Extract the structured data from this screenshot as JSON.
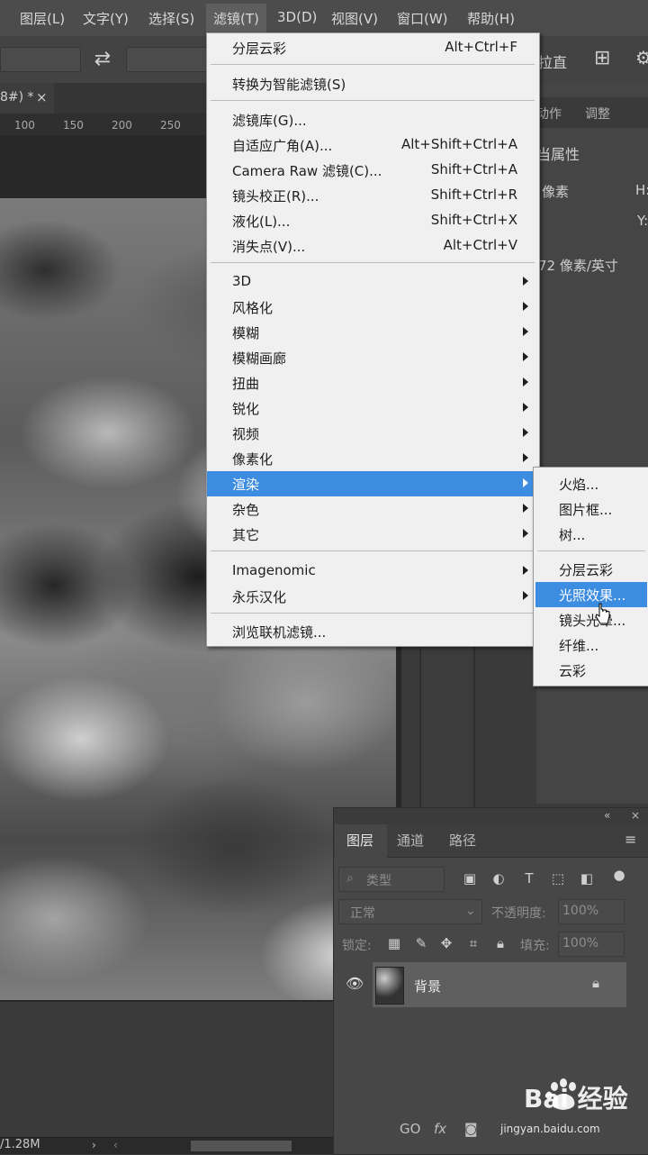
{
  "menubar": {
    "items": [
      "图层(L)",
      "文字(Y)",
      "选择(S)",
      "滤镜(T)",
      "3D(D)",
      "视图(V)",
      "窗口(W)",
      "帮助(H)"
    ]
  },
  "options_bar": {
    "right_label": "拉直"
  },
  "document": {
    "tab_title": "8#) *",
    "close": "×"
  },
  "ruler": {
    "ticks": [
      "100",
      "150",
      "200",
      "250"
    ]
  },
  "right_panel": {
    "tabs": [
      "动作",
      "调整"
    ],
    "title": "当属性",
    "unit": "像素",
    "h_label": "H:",
    "y_label": "Y:",
    "resolution": "72 像素/英寸"
  },
  "filter_menu": {
    "items": [
      {
        "label": "分层云彩",
        "shortcut": "Alt+Ctrl+F"
      },
      {
        "label": "转换为智能滤镜(S)"
      },
      {
        "label": "滤镜库(G)..."
      },
      {
        "label": "自适应广角(A)...",
        "shortcut": "Alt+Shift+Ctrl+A"
      },
      {
        "label": "Camera Raw 滤镜(C)...",
        "shortcut": "Shift+Ctrl+A"
      },
      {
        "label": "镜头校正(R)...",
        "shortcut": "Shift+Ctrl+R"
      },
      {
        "label": "液化(L)...",
        "shortcut": "Shift+Ctrl+X"
      },
      {
        "label": "消失点(V)...",
        "shortcut": "Alt+Ctrl+V"
      },
      {
        "label": "3D"
      },
      {
        "label": "风格化"
      },
      {
        "label": "模糊"
      },
      {
        "label": "模糊画廊"
      },
      {
        "label": "扭曲"
      },
      {
        "label": "锐化"
      },
      {
        "label": "视频"
      },
      {
        "label": "像素化"
      },
      {
        "label": "渲染"
      },
      {
        "label": "杂色"
      },
      {
        "label": "其它"
      },
      {
        "label": "Imagenomic"
      },
      {
        "label": "永乐汉化"
      },
      {
        "label": "浏览联机滤镜..."
      }
    ]
  },
  "render_submenu": {
    "items": [
      "火焰...",
      "图片框...",
      "树...",
      "分层云彩",
      "光照效果...",
      "镜头光晕...",
      "纤维...",
      "云彩"
    ]
  },
  "layers_panel": {
    "tabs": [
      "图层",
      "通道",
      "路径"
    ],
    "filter_kind": "类型",
    "blend_mode": "正常",
    "opacity_label": "不透明度:",
    "opacity_value": "100%",
    "lock_label": "锁定:",
    "fill_label": "填充:",
    "fill_value": "100%",
    "layer_name": "背景",
    "bottom_link": "GO",
    "bottom_fx": "fx"
  },
  "status": {
    "doc_size": "/1.28M"
  },
  "watermark": {
    "brand": "Bai 经验",
    "url": "jingyan.baidu.com"
  }
}
